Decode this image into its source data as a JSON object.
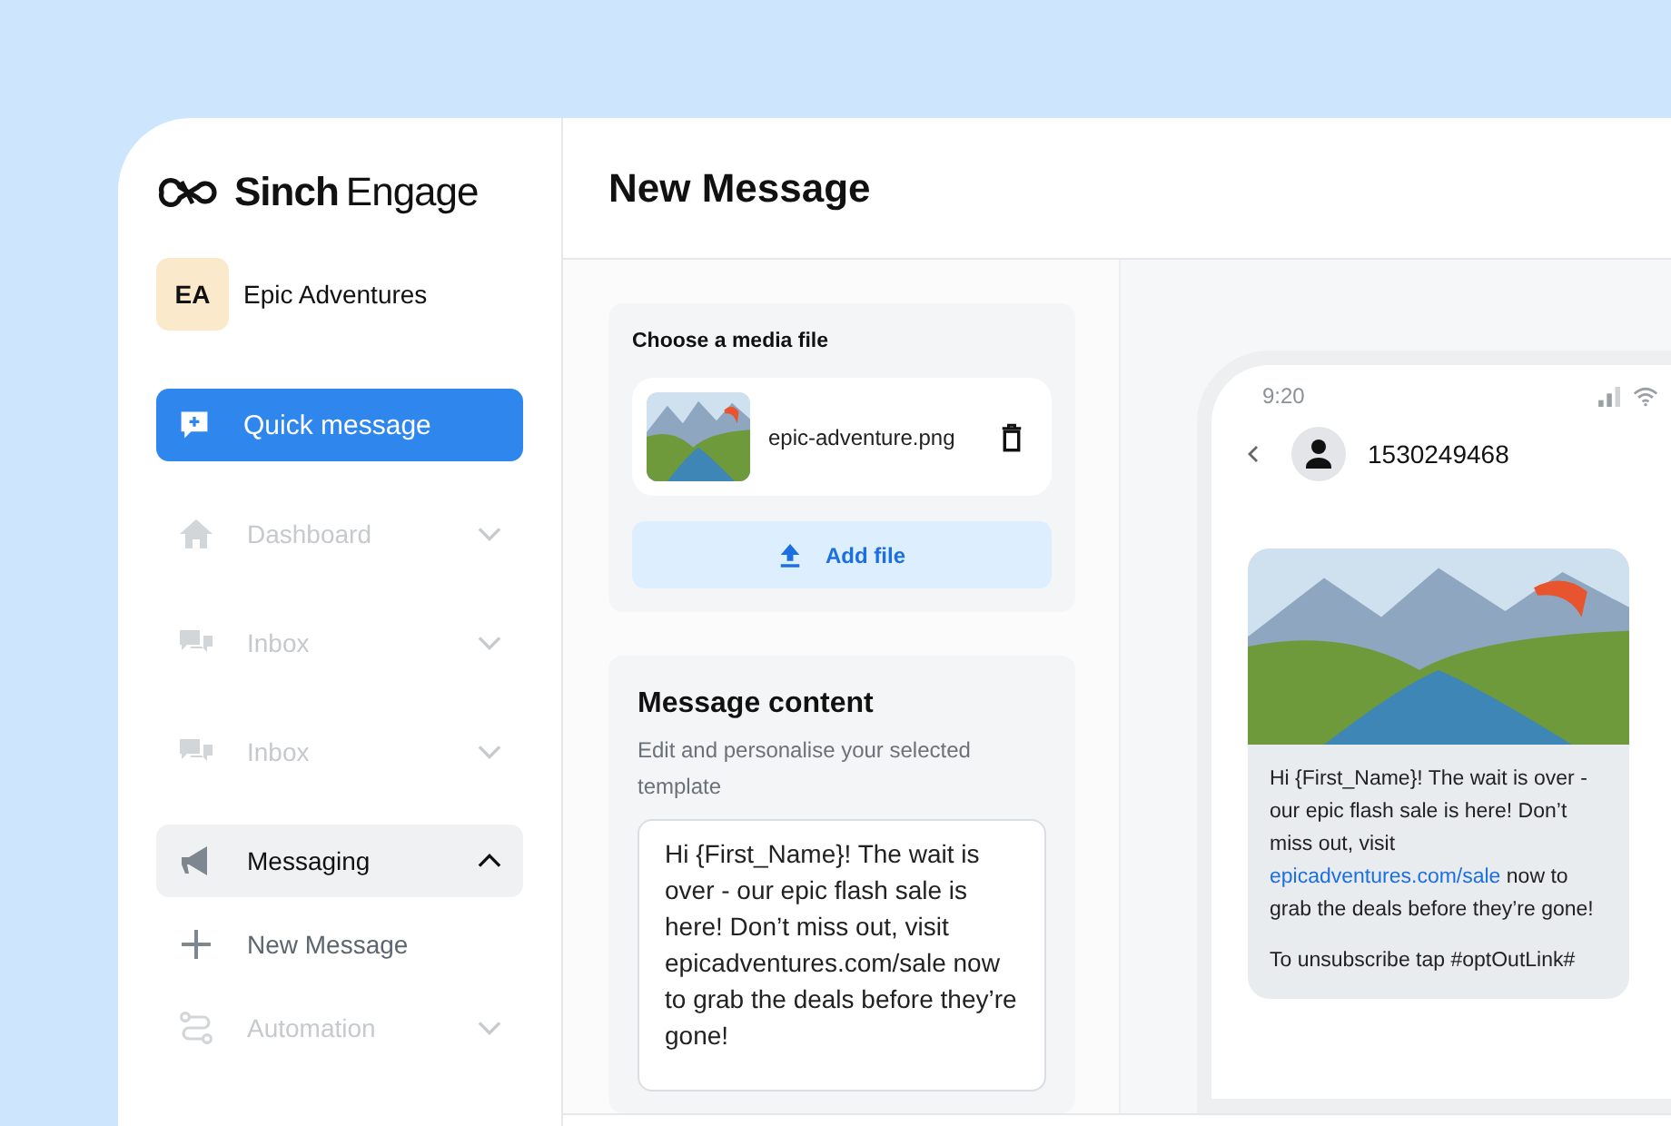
{
  "logo": {
    "brand": "Sinch",
    "product": "Engage"
  },
  "account": {
    "initials": "EA",
    "name": "Epic Adventures"
  },
  "quick_action": {
    "label": "Quick message"
  },
  "nav": [
    {
      "label": "Dashboard",
      "disabled": true,
      "selected": false,
      "expanded": false
    },
    {
      "label": "Inbox",
      "disabled": true,
      "selected": false,
      "expanded": false
    },
    {
      "label": "Inbox",
      "disabled": true,
      "selected": false,
      "expanded": false
    },
    {
      "label": "Messaging",
      "disabled": false,
      "selected": true,
      "expanded": true,
      "children": [
        {
          "label": "New Message",
          "disabled": false,
          "selected": false
        }
      ]
    },
    {
      "label": "Automation",
      "disabled": true,
      "selected": false,
      "expanded": false
    }
  ],
  "page_title": "New Message",
  "media": {
    "title": "Choose a media file",
    "file_name": "epic-adventure.png",
    "add_button": "Add file"
  },
  "content": {
    "title": "Message content",
    "subtitle": "Edit and personalise your selected template",
    "value": "Hi {First_Name}! The wait is over - our epic flash sale is here! Don’t miss out, visit epicadventures.com/sale now to grab the deals before they’re gone!"
  },
  "preview": {
    "time": "9:20",
    "contact": "1530249468",
    "text_before": "Hi {First_Name}! The wait is over - our epic flash sale is here! Don’t miss out, visit",
    "link": "epicadventures.com/sale",
    "text_after": "now to grab the deals before they’re gone!",
    "footer": "To unsubscribe tap #optOutLink#"
  }
}
